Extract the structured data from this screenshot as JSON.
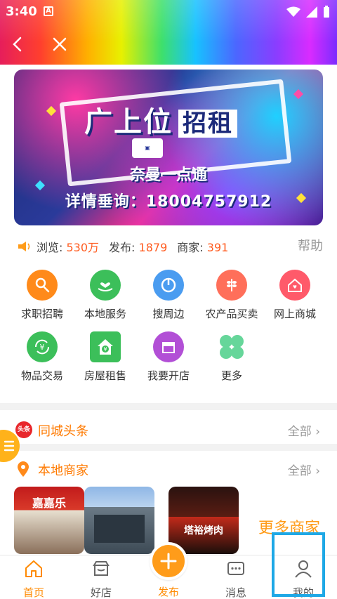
{
  "status_bar": {
    "time": "3:40",
    "indicator_letter": "A"
  },
  "banner": {
    "title": "广上位",
    "title_accent": "招租",
    "subtitle": "奈曼一点通",
    "phone_line": "详情垂询：18004757912"
  },
  "stats": {
    "views_label": "浏览:",
    "views_value": "530万",
    "posts_label": "发布:",
    "posts_value": "1879",
    "merchants_label": "商家:",
    "merchants_value": "391",
    "help": "帮助"
  },
  "services": [
    {
      "label": "求职招聘",
      "icon": "person-search-icon",
      "color": "#ff8a1a"
    },
    {
      "label": "本地服务",
      "icon": "hand-heart-icon",
      "color": "#3cbf5a"
    },
    {
      "label": "搜周边",
      "icon": "location-dial-icon",
      "color": "#4a9cf0"
    },
    {
      "label": "农产品买卖",
      "icon": "wheat-icon",
      "color": "#ff6f5a"
    },
    {
      "label": "网上商城",
      "icon": "house-heart-icon",
      "color": "#ff5a6a"
    },
    {
      "label": "物品交易",
      "icon": "yen-exchange-icon",
      "color": "#3cbf5a"
    },
    {
      "label": "房屋租售",
      "icon": "house-yen-icon",
      "color": "#3cbf5a"
    },
    {
      "label": "我要开店",
      "icon": "storefront-icon",
      "color": "#b24fd6"
    },
    {
      "label": "更多",
      "icon": "clover-icon",
      "color": "#66d69a"
    }
  ],
  "sections": {
    "headlines": {
      "title": "同城头条",
      "badge": "头条",
      "more": "全部"
    },
    "merchants": {
      "title": "本地商家",
      "more": "全部",
      "more_shops": "更多商家"
    }
  },
  "shop_signs": [
    "嘉嘉乐",
    "",
    "塔裕烤肉"
  ],
  "tabbar": {
    "tabs": [
      {
        "label": "首页",
        "icon": "home-icon",
        "active": true
      },
      {
        "label": "好店",
        "icon": "shop-icon",
        "active": false
      },
      {
        "label": "发布",
        "icon": "plus-icon",
        "active": false
      },
      {
        "label": "消息",
        "icon": "message-icon",
        "active": false
      },
      {
        "label": "我的",
        "icon": "user-icon",
        "active": false
      }
    ]
  },
  "colors": {
    "accent": "#ff8a00",
    "number": "#ff5b1f",
    "highlight": "#1ea8e6"
  }
}
